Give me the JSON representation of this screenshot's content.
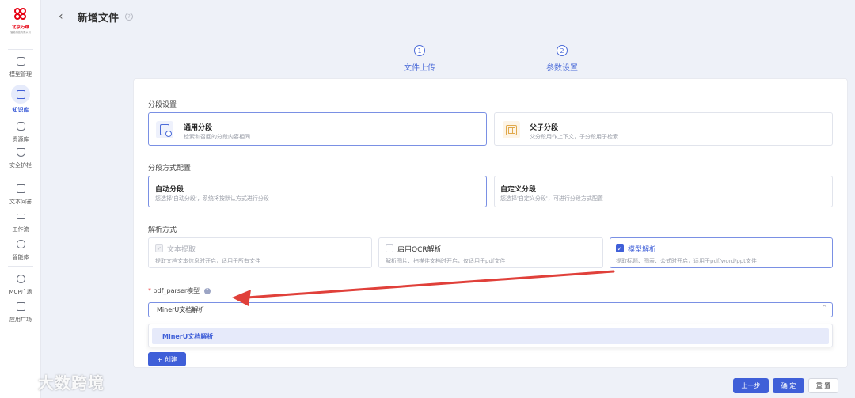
{
  "brand": {
    "name": "北京万维",
    "sub": "智能科技有限公司",
    "accent": "#3f5fd8",
    "logo_color": "#e60012"
  },
  "sidebar": {
    "items": [
      {
        "label": "模型管理",
        "icon": "cube-icon"
      },
      {
        "label": "知识库",
        "icon": "book-icon",
        "active": true
      },
      {
        "label": "资源库",
        "icon": "database-icon"
      },
      {
        "label": "安全护栏",
        "icon": "shield-icon"
      },
      {
        "label": "文本问答",
        "icon": "text-icon"
      },
      {
        "label": "工作流",
        "icon": "workflow-icon"
      },
      {
        "label": "智能体",
        "icon": "robot-icon"
      },
      {
        "label": "MCP广场",
        "icon": "mcp-icon"
      },
      {
        "label": "应用广场",
        "icon": "app-icon"
      }
    ]
  },
  "header": {
    "title": "新增文件",
    "back_glyph": "‹",
    "help_glyph": "?"
  },
  "steps": [
    {
      "num": "1",
      "label": "文件上传"
    },
    {
      "num": "2",
      "label": "参数设置"
    }
  ],
  "segment": {
    "label": "分段设置",
    "options": [
      {
        "title": "通用分段",
        "desc": "检索和召回的分段内容相同",
        "selected": true
      },
      {
        "title": "父子分段",
        "desc": "父分段用作上下文，子分段用于检索",
        "selected": false
      }
    ]
  },
  "method": {
    "label": "分段方式配置",
    "options": [
      {
        "title": "自动分段",
        "desc": "您选择'自动分段'，系统将按默认方式进行分段",
        "selected": true
      },
      {
        "title": "自定义分段",
        "desc": "您选择'自定义分段'，可进行分段方式配置",
        "selected": false
      }
    ]
  },
  "parse": {
    "label": "解析方式",
    "options": [
      {
        "title": "文本提取",
        "desc": "提取文档文本信息时开启，适用于所有文件",
        "state": "disabled-checked"
      },
      {
        "title": "启用OCR解析",
        "desc": "解析图片、扫描件文档时开启，仅适用于pdf文件",
        "state": "unchecked"
      },
      {
        "title": "模型解析",
        "desc": "提取标题、图表、公式时开启，适用于pdf/word/ppt文件",
        "state": "checked"
      }
    ]
  },
  "parser_field": {
    "required_mark": "*",
    "label": "pdf_parser模型",
    "info_glyph": "?",
    "value": "MinerU文档解析",
    "caret": "⌃"
  },
  "dropdown": {
    "options": [
      "MinerU文档解析"
    ]
  },
  "create_button": {
    "icon": "+",
    "label": "创建"
  },
  "footer": {
    "prev": "上一步",
    "confirm": "确 定",
    "reset": "重 置"
  },
  "watermark": {
    "text": "大数跨境"
  },
  "annotation": {
    "arrow_color": "#e0403a"
  }
}
